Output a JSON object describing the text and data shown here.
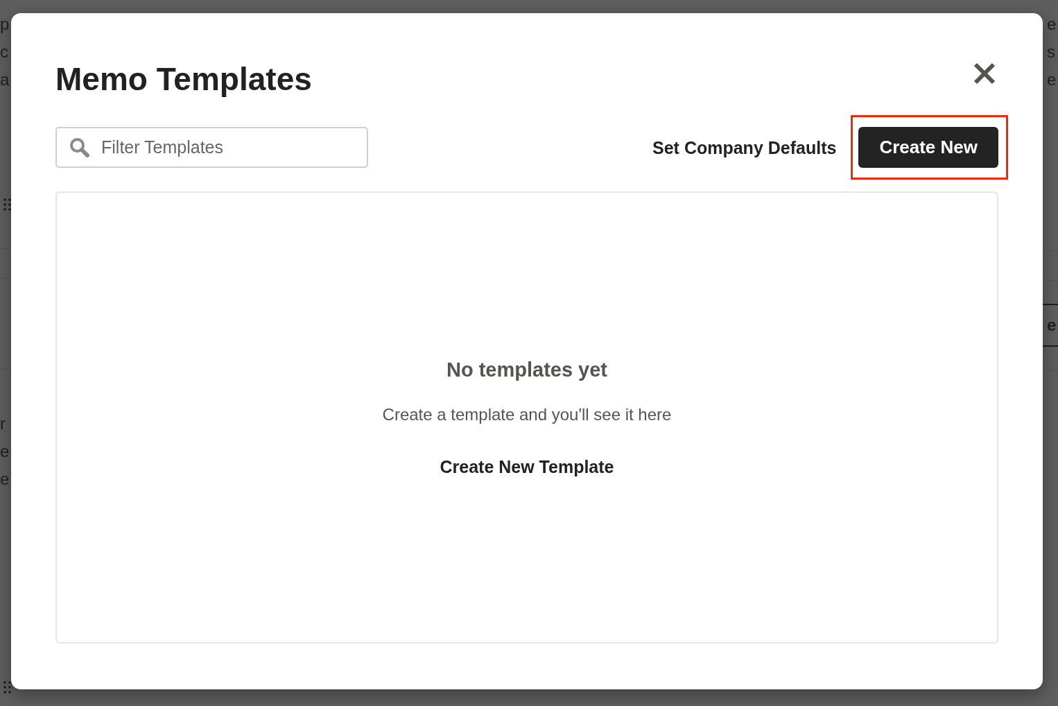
{
  "background_page": {
    "left_edge": {
      "upper_lines": [
        "p",
        "c",
        "a"
      ],
      "lower_lines": [
        "r",
        "e",
        "e"
      ]
    },
    "right_edge": {
      "upper_lines": [
        "e",
        "s",
        "e"
      ],
      "header_cell": "e"
    }
  },
  "modal": {
    "title": "Memo Templates",
    "search": {
      "placeholder": "Filter Templates"
    },
    "actions": [
      {
        "label": "Set Company Defaults",
        "kind": "link",
        "highlighted": false
      },
      {
        "label": "Create New",
        "kind": "primary",
        "highlighted": true
      }
    ],
    "empty_state": {
      "heading": "No templates yet",
      "message": "Create a template and you'll see it here",
      "action": "Create New Template"
    }
  }
}
